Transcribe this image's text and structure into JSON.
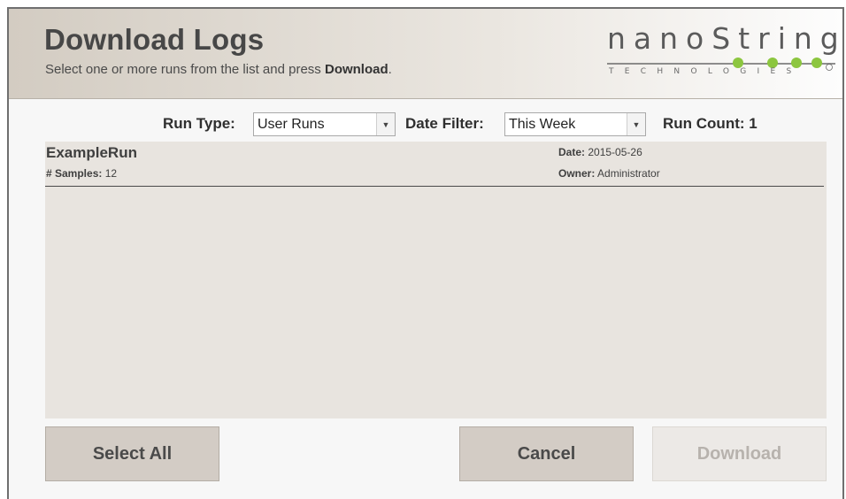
{
  "header": {
    "title": "Download Logs",
    "subtitle_prefix": "Select one or more runs from the list and press ",
    "subtitle_bold": "Download",
    "subtitle_suffix": ".",
    "logo_word": "nanoString",
    "logo_sub": "TECHNOLOGIES"
  },
  "filters": {
    "run_type_label": "Run Type:",
    "run_type_value": "User Runs",
    "date_filter_label": "Date Filter:",
    "date_filter_value": "This Week",
    "run_count_label": "Run Count:",
    "run_count_value": "1"
  },
  "runs": [
    {
      "name": "ExampleRun",
      "samples_label": "# Samples:",
      "samples_value": "12",
      "date_label": "Date:",
      "date_value": "2015-05-26",
      "owner_label": "Owner:",
      "owner_value": "Administrator"
    }
  ],
  "buttons": {
    "select_all": "Select All",
    "cancel": "Cancel",
    "download": "Download"
  },
  "colors": {
    "logo_green": "#8cc63f",
    "button_bg": "#d3ccc5",
    "list_bg": "#e8e4df"
  }
}
